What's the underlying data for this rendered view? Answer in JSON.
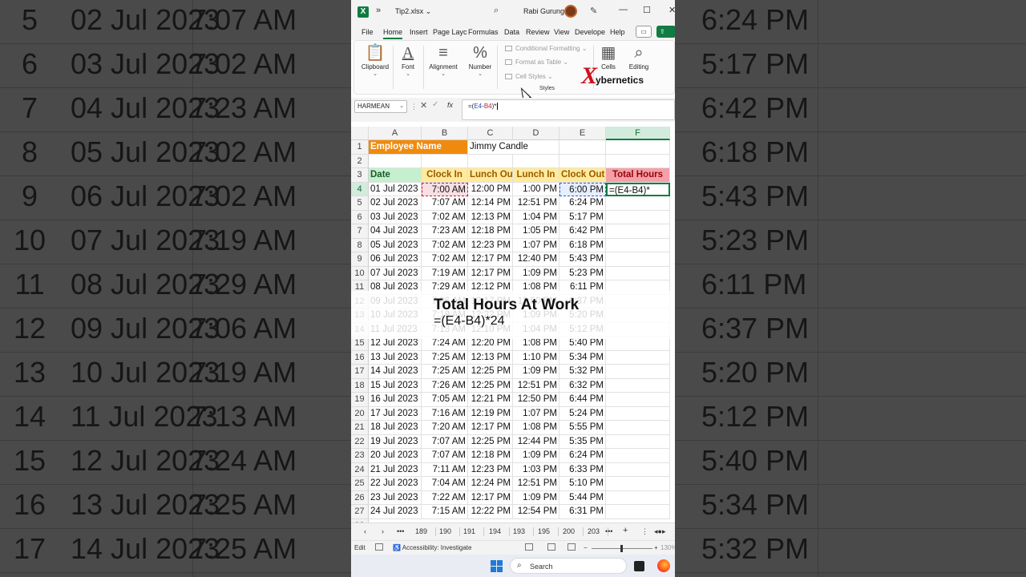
{
  "background": {
    "rows": [
      {
        "num": "5",
        "date": "02 Jul 2023",
        "time": "7:07 AM",
        "out": "6:24 PM"
      },
      {
        "num": "6",
        "date": "03 Jul 2023",
        "time": "7:02 AM",
        "out": "5:17 PM"
      },
      {
        "num": "7",
        "date": "04 Jul 2023",
        "time": "7:23 AM",
        "out": "6:42 PM"
      },
      {
        "num": "8",
        "date": "05 Jul 2023",
        "time": "7:02 AM",
        "out": "6:18 PM"
      },
      {
        "num": "9",
        "date": "06 Jul 2023",
        "time": "7:02 AM",
        "out": "5:43 PM"
      },
      {
        "num": "10",
        "date": "07 Jul 2023",
        "time": "7:19 AM",
        "out": "5:23 PM"
      },
      {
        "num": "11",
        "date": "08 Jul 2023",
        "time": "7:29 AM",
        "out": "6:11 PM"
      },
      {
        "num": "12",
        "date": "09 Jul 2023",
        "time": "7:06 AM",
        "out": "6:37 PM"
      },
      {
        "num": "13",
        "date": "10 Jul 2023",
        "time": "7:19 AM",
        "out": "5:20 PM"
      },
      {
        "num": "14",
        "date": "11 Jul 2023",
        "time": "7:13 AM",
        "out": "5:12 PM"
      },
      {
        "num": "15",
        "date": "12 Jul 2023",
        "time": "7:24 AM",
        "out": "5:40 PM"
      },
      {
        "num": "16",
        "date": "13 Jul 2023",
        "time": "7:25 AM",
        "out": "5:34 PM"
      },
      {
        "num": "17",
        "date": "14 Jul 2023",
        "time": "7:25 AM",
        "out": "5:32 PM"
      }
    ]
  },
  "titlebar": {
    "logo": "X",
    "more": "»",
    "filename": "Tip2.xlsx ⌄",
    "user": "Rabi Gurung",
    "minimize": "—",
    "maximize": "☐",
    "close": "✕"
  },
  "tabs": [
    "File",
    "Home",
    "Insert",
    "Page Layc",
    "Formulas",
    "Data",
    "Review",
    "View",
    "Develope",
    "Help"
  ],
  "ribbon": {
    "clipboard": "Clipboard",
    "font": "Font",
    "alignment": "Alignment",
    "number": "Number",
    "number_symbol": "%",
    "conditional": "Conditional Formatting ⌄",
    "format_table": "Format as Table ⌄",
    "cell_styles": "Cell Styles ⌄",
    "styles": "Styles",
    "cells": "Cells",
    "editing": "Editing"
  },
  "brand": {
    "mark": "X",
    "word": "ybernetics"
  },
  "formula_bar": {
    "name_box": "HARMEAN",
    "fx": "fx",
    "formula_prefix": "=(",
    "ref1": "E4",
    "formula_mid": "-",
    "ref2": "B4",
    "formula_suffix": ")*"
  },
  "grid": {
    "columns": [
      "A",
      "B",
      "C",
      "D",
      "E",
      "F"
    ],
    "row_numbers": [
      "1",
      "2",
      "3",
      "4",
      "5",
      "6",
      "7",
      "8",
      "9",
      "10",
      "11",
      "12",
      "13",
      "14",
      "15",
      "16",
      "17",
      "18",
      "19",
      "20",
      "21",
      "22",
      "23",
      "24",
      "25",
      "26",
      "27",
      "28"
    ],
    "employee_label": "Employee Name",
    "employee_name": "Jimmy Candle",
    "headers": [
      "Date",
      "Clock In",
      "Lunch Out",
      "Lunch In",
      "Clock Out",
      "Total Hours"
    ],
    "editing_cell": "=(E4-B4)*",
    "rows": [
      [
        "01 Jul 2023",
        "7:00 AM",
        "12:00 PM",
        "1:00 PM",
        "6:00 PM"
      ],
      [
        "02 Jul 2023",
        "7:07 AM",
        "12:14 PM",
        "12:51 PM",
        "6:24 PM"
      ],
      [
        "03 Jul 2023",
        "7:02 AM",
        "12:13 PM",
        "1:04 PM",
        "5:17 PM"
      ],
      [
        "04 Jul 2023",
        "7:23 AM",
        "12:18 PM",
        "1:05 PM",
        "6:42 PM"
      ],
      [
        "05 Jul 2023",
        "7:02 AM",
        "12:23 PM",
        "1:07 PM",
        "6:18 PM"
      ],
      [
        "06 Jul 2023",
        "7:02 AM",
        "12:17 PM",
        "12:40 PM",
        "5:43 PM"
      ],
      [
        "07 Jul 2023",
        "7:19 AM",
        "12:17 PM",
        "1:09 PM",
        "5:23 PM"
      ],
      [
        "08 Jul 2023",
        "7:29 AM",
        "12:12 PM",
        "1:08 PM",
        "6:11 PM"
      ],
      [
        "09 Jul 2023",
        "7:06 AM",
        "12:17 PM",
        "12:50 PM",
        "6:37 PM"
      ],
      [
        "10 Jul 2023",
        "7:19 AM",
        "12:22 PM",
        "1:09 PM",
        "5:20 PM"
      ],
      [
        "11 Jul 2023",
        "7:13 AM",
        "12:10 PM",
        "1:04 PM",
        "5:12 PM"
      ],
      [
        "12 Jul 2023",
        "7:24 AM",
        "12:20 PM",
        "1:08 PM",
        "5:40 PM"
      ],
      [
        "13 Jul 2023",
        "7:25 AM",
        "12:13 PM",
        "1:10 PM",
        "5:34 PM"
      ],
      [
        "14 Jul 2023",
        "7:25 AM",
        "12:25 PM",
        "1:09 PM",
        "5:32 PM"
      ],
      [
        "15 Jul 2023",
        "7:26 AM",
        "12:25 PM",
        "12:51 PM",
        "6:32 PM"
      ],
      [
        "16 Jul 2023",
        "7:05 AM",
        "12:21 PM",
        "12:50 PM",
        "6:44 PM"
      ],
      [
        "17 Jul 2023",
        "7:16 AM",
        "12:19 PM",
        "1:07 PM",
        "5:24 PM"
      ],
      [
        "18 Jul 2023",
        "7:20 AM",
        "12:17 PM",
        "1:08 PM",
        "5:55 PM"
      ],
      [
        "19 Jul 2023",
        "7:07 AM",
        "12:25 PM",
        "12:44 PM",
        "5:35 PM"
      ],
      [
        "20 Jul 2023",
        "7:07 AM",
        "12:18 PM",
        "1:09 PM",
        "6:24 PM"
      ],
      [
        "21 Jul 2023",
        "7:11 AM",
        "12:23 PM",
        "1:03 PM",
        "6:33 PM"
      ],
      [
        "22 Jul 2023",
        "7:04 AM",
        "12:24 PM",
        "12:51 PM",
        "5:10 PM"
      ],
      [
        "23 Jul 2023",
        "7:22 AM",
        "12:17 PM",
        "1:09 PM",
        "5:44 PM"
      ],
      [
        "24 Jul 2023",
        "7:15 AM",
        "12:22 PM",
        "12:54 PM",
        "6:31 PM"
      ]
    ]
  },
  "overlay": {
    "title": "Total Hours At Work",
    "formula": "=(E4-B4)*24"
  },
  "sheet_tabs": [
    "189",
    "190",
    "191",
    "194",
    "193",
    "195",
    "200",
    "203"
  ],
  "sheet_controls": {
    "prev": "‹",
    "next": "›",
    "more_left": "•••",
    "more_right": "•••",
    "add": "+",
    "menu": "⋮",
    "nav": "◂●▸"
  },
  "status": {
    "mode": "Edit",
    "accessibility": "Accessibility: Investigate",
    "zoom": "130%"
  },
  "taskbar": {
    "search_label": "Search"
  }
}
